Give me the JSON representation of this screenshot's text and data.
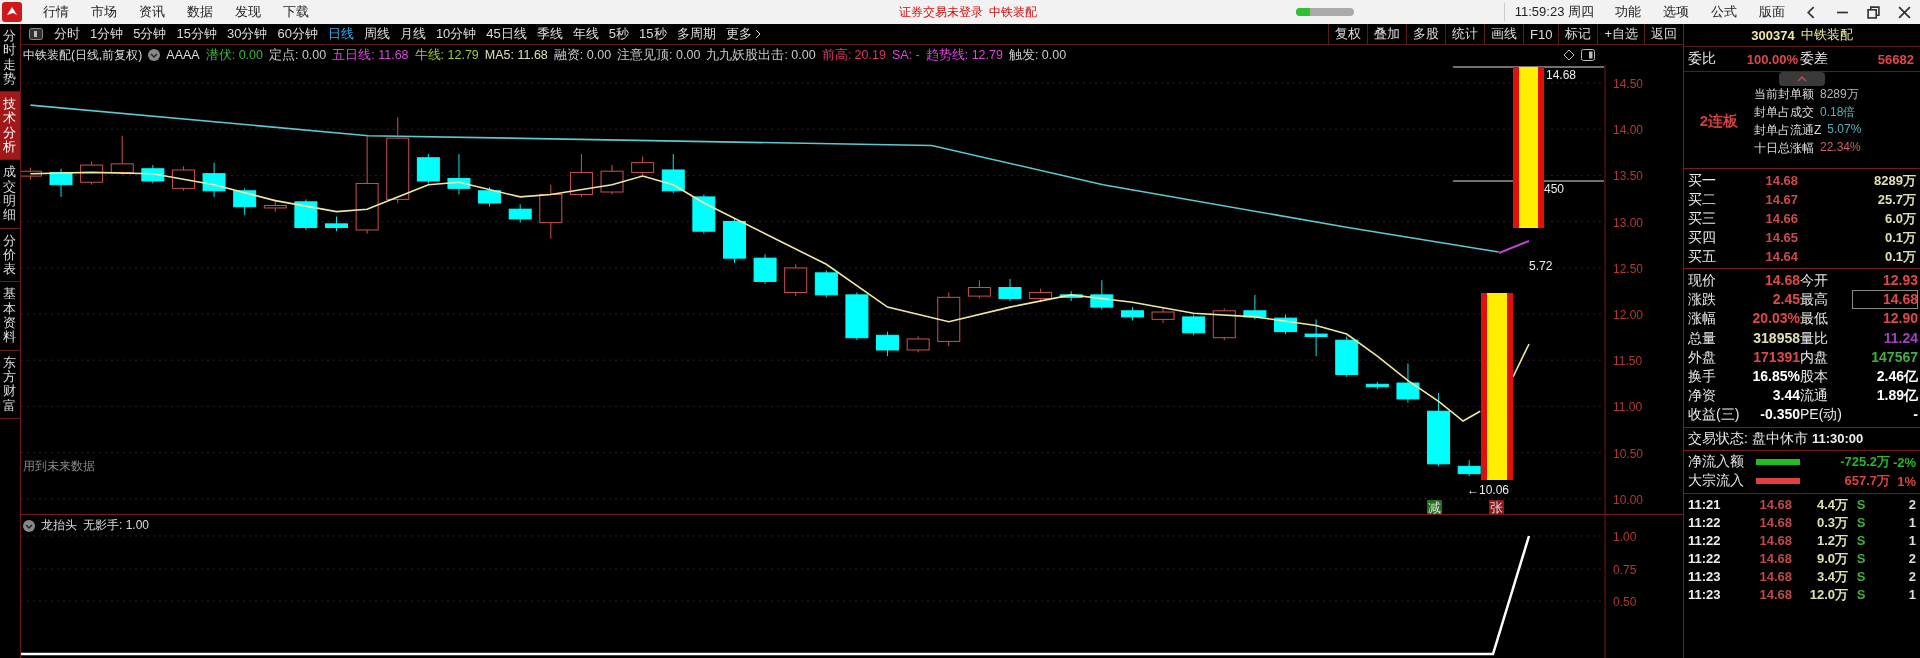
{
  "title_bar": {
    "menu": [
      "行情",
      "市场",
      "资讯",
      "数据",
      "发现",
      "下载"
    ],
    "notice": "证券交易未登录  中铁装配",
    "progress": {
      "level": 0.25
    },
    "clock": "11:59:23 周四",
    "actions": [
      "功能",
      "选项",
      "公式",
      "版面"
    ]
  },
  "side_tabs": [
    {
      "label": "分时走势",
      "selected": false
    },
    {
      "label": "技术分析",
      "selected": true
    },
    {
      "label": "成交明细",
      "selected": false
    },
    {
      "label": "分价表",
      "selected": false
    },
    {
      "label": "基本资料",
      "selected": false
    },
    {
      "label": "东方财富",
      "selected": false
    }
  ],
  "period_tabs": [
    {
      "label": "分时",
      "selected": false
    },
    {
      "label": "1分钟",
      "selected": false
    },
    {
      "label": "5分钟",
      "selected": false
    },
    {
      "label": "15分钟",
      "selected": false
    },
    {
      "label": "30分钟",
      "selected": false
    },
    {
      "label": "60分钟",
      "selected": false
    },
    {
      "label": "日线",
      "selected": true
    },
    {
      "label": "周线",
      "selected": false
    },
    {
      "label": "月线",
      "selected": false
    },
    {
      "label": "10分钟",
      "selected": false
    },
    {
      "label": "45日线",
      "selected": false
    },
    {
      "label": "季线",
      "selected": false
    },
    {
      "label": "年线",
      "selected": false
    },
    {
      "label": "5秒",
      "selected": false
    },
    {
      "label": "15秒",
      "selected": false
    },
    {
      "label": "多周期",
      "selected": false
    },
    {
      "label": "更多",
      "selected": false
    }
  ],
  "tools": [
    "复权",
    "叠加",
    "多股",
    "统计",
    "画线",
    "F10",
    "标记",
    "+自选",
    "返回"
  ],
  "info_line": {
    "title": "中铁装配(日线,前复权)",
    "formula": "AAAA",
    "items": [
      {
        "text": "潜伏: 0.00",
        "color": "#33bb33"
      },
      {
        "text": "定点: 0.00",
        "color": "#c8c8c8"
      },
      {
        "text": "五日线: 11.68",
        "color": "#dd44dd"
      },
      {
        "text": "牛线: 12.79",
        "color": "#99cc33"
      },
      {
        "text": "MA5: 11.68",
        "color": "#e0e0b0"
      },
      {
        "text": "融资: 0.00",
        "color": "#c8c8c8"
      },
      {
        "text": "注意见顶: 0.00",
        "color": "#c8c8c8"
      },
      {
        "text": "九九妖股出击: 0.00",
        "color": "#c8c8c8"
      },
      {
        "text": "前高: 20.19",
        "color": "#dd3366"
      },
      {
        "text": "SA: -",
        "color": "#dd44dd"
      },
      {
        "text": "趋势线: 12.79",
        "color": "#dd44dd"
      },
      {
        "text": "触发: 0.00",
        "color": "#c8c8c8"
      }
    ]
  },
  "chart": {
    "price_axis": [
      "14.50",
      "14.00",
      "13.50",
      "13.00",
      "12.50",
      "12.00",
      "11.50",
      "11.00",
      "10.50",
      "10.00"
    ],
    "labels": [
      "14.68",
      "450",
      "5.72",
      "←10.06"
    ],
    "badges": [
      {
        "text": "减",
        "color": "#1f6f1f"
      },
      {
        "text": "张",
        "color": "#8a1a1a"
      }
    ],
    "note": "用到未来数据"
  },
  "indicator": {
    "title": "龙抬头",
    "value": "无影手: 1.00",
    "axis": [
      "1.00",
      "0.75",
      "0.50"
    ]
  },
  "quote_panel": {
    "code": "300374",
    "name": "中铁装配",
    "ratio": [
      {
        "label": "委比",
        "value": "100.00%"
      },
      {
        "label": "委差",
        "value": "56682"
      }
    ],
    "limit_up": {
      "streak": "2连板",
      "stats": [
        {
          "label": "当前封单额",
          "value": "8289万",
          "color": "#b8b8b8"
        },
        {
          "label": "封单占成交",
          "value": "0.18倍",
          "color": "#5ab0c0"
        },
        {
          "label": "封单占流通Z",
          "value": "5.07%",
          "color": "#5ab0c0"
        },
        {
          "label": "十日总涨幅",
          "value": "22.34%",
          "color": "#c86060"
        }
      ]
    },
    "bids": [
      {
        "label": "买一",
        "price": "14.68",
        "volume": "8289万"
      },
      {
        "label": "买二",
        "price": "14.67",
        "volume": "25.7万"
      },
      {
        "label": "买三",
        "price": "14.66",
        "volume": "6.0万"
      },
      {
        "label": "买四",
        "price": "14.65",
        "volume": "0.1万"
      },
      {
        "label": "买五",
        "price": "14.64",
        "volume": "0.1万"
      }
    ],
    "quotes": [
      {
        "label": "现价",
        "value": "14.68",
        "color": "#e04848",
        "highlighted": false
      },
      {
        "label": "今开",
        "value": "12.93",
        "color": "#e04848",
        "highlighted": false
      },
      {
        "label": "涨跌",
        "value": "2.45",
        "color": "#e04848",
        "highlighted": false
      },
      {
        "label": "最高",
        "value": "14.68",
        "color": "#e04848",
        "highlighted": true
      },
      {
        "label": "涨幅",
        "value": "20.03%",
        "color": "#e04848",
        "highlighted": false
      },
      {
        "label": "最低",
        "value": "12.90",
        "color": "#e04848",
        "highlighted": false
      },
      {
        "label": "总量",
        "value": "318958",
        "color": "#e0e0b0",
        "highlighted": false
      },
      {
        "label": "量比",
        "value": "11.24",
        "color": "#a040c0",
        "highlighted": false
      },
      {
        "label": "外盘",
        "value": "171391",
        "color": "#e04848",
        "highlighted": false
      },
      {
        "label": "内盘",
        "value": "147567",
        "color": "#40b040",
        "highlighted": false
      },
      {
        "label": "换手",
        "value": "16.85%",
        "color": "#ffffff",
        "highlighted": false
      },
      {
        "label": "股本",
        "value": "2.46亿",
        "color": "#ffffff",
        "highlighted": false
      },
      {
        "label": "净资",
        "value": "3.44",
        "color": "#ffffff",
        "highlighted": false
      },
      {
        "label": "流通",
        "value": "1.89亿",
        "color": "#ffffff",
        "highlighted": false
      },
      {
        "label": "收益(三)",
        "value": "-0.350",
        "color": "#ffffff",
        "highlighted": false
      },
      {
        "label": "PE(动)",
        "value": "-",
        "color": "#ffffff",
        "highlighted": false
      }
    ],
    "status": {
      "label": "交易状态:",
      "state": "盘中休市",
      "time": "11:30:00"
    },
    "flows": [
      {
        "label": "净流入额",
        "color": "#22bb22",
        "amount": "-725.2万",
        "percent": "-2%"
      },
      {
        "label": "大宗流入",
        "color": "#e04040",
        "amount": "657.7万",
        "percent": "1%"
      }
    ],
    "ticks": [
      {
        "time": "11:21",
        "price": "14.68",
        "volume": "4.4万",
        "side": "S",
        "count": "2"
      },
      {
        "time": "11:22",
        "price": "14.68",
        "volume": "0.3万",
        "side": "S",
        "count": "1"
      },
      {
        "time": "11:22",
        "price": "14.68",
        "volume": "1.2万",
        "side": "S",
        "count": "1"
      },
      {
        "time": "11:22",
        "price": "14.68",
        "volume": "9.0万",
        "side": "S",
        "count": "2"
      },
      {
        "time": "11:23",
        "price": "14.68",
        "volume": "3.4万",
        "side": "S",
        "count": "2"
      },
      {
        "time": "11:23",
        "price": "14.68",
        "volume": "12.0万",
        "side": "S",
        "count": "1"
      }
    ]
  }
}
